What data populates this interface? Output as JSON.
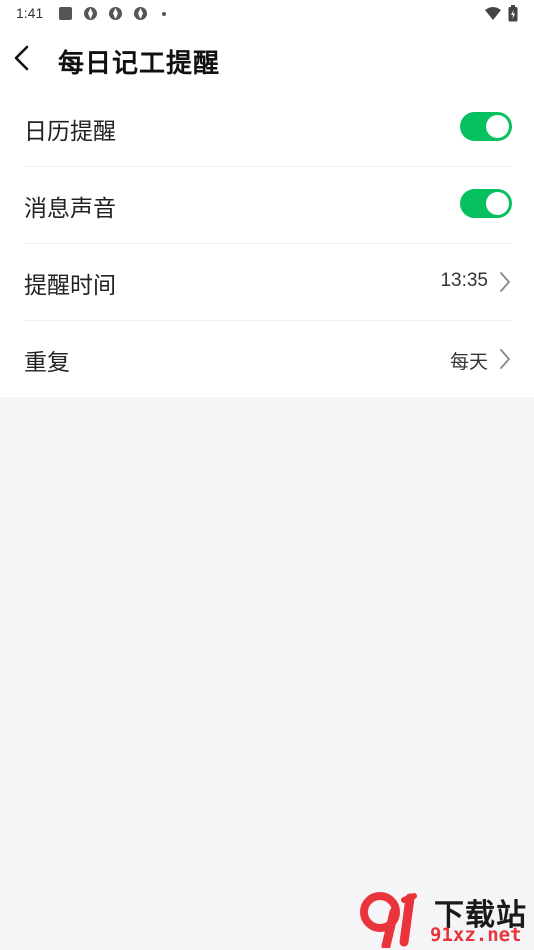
{
  "status_bar": {
    "time": "1:41"
  },
  "header": {
    "title": "每日记工提醒"
  },
  "settings": {
    "calendar_reminder": {
      "label": "日历提醒",
      "enabled": true
    },
    "message_sound": {
      "label": "消息声音",
      "enabled": true
    },
    "reminder_time": {
      "label": "提醒时间",
      "value": "13:35"
    },
    "repeat": {
      "label": "重复",
      "value": "每天"
    }
  },
  "watermark": {
    "text_cn": "下载站",
    "text_url": "91xz.net"
  },
  "colors": {
    "toggle_on": "#07c160",
    "background": "#f5f5f7",
    "watermark_red": "#e8343a"
  }
}
